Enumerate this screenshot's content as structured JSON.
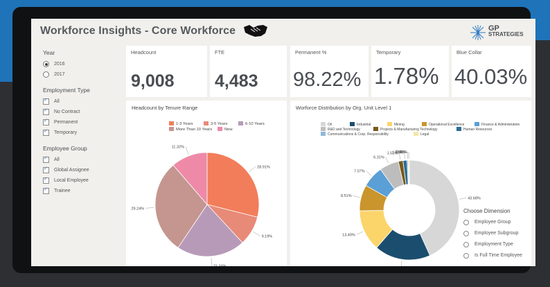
{
  "header": {
    "title": "Workforce Insights - Core Workforce",
    "logo_line1": "GP",
    "logo_line2": "STRATEGIES"
  },
  "filters": {
    "year": {
      "title": "Year",
      "options": [
        "2016",
        "2017"
      ],
      "selected": "2016"
    },
    "employment_type": {
      "title": "Employment Type",
      "options": [
        "All",
        "No Contract",
        "Permanent",
        "Temporary"
      ]
    },
    "employee_group": {
      "title": "Employee Group",
      "options": [
        "All",
        "Global Assignee",
        "Local Employee",
        "Trainee"
      ]
    }
  },
  "kpis": [
    {
      "label": "Headcount",
      "value": "9,008"
    },
    {
      "label": "FTE",
      "value": "4,483"
    },
    {
      "label": "Permanent %",
      "value": "98.22%"
    },
    {
      "label": "Temporary",
      "value": "1.78%"
    },
    {
      "label": "Blue Collar",
      "value": "40.03%"
    }
  ],
  "tenure_chart": {
    "title": "Headcount by Tenure Range"
  },
  "org_chart": {
    "title": "Worforce Distribution by Org. Unit Level 1"
  },
  "dimension": {
    "title": "Choose Dimension",
    "options": [
      "Employee Group",
      "Employee Subgroup",
      "Employment Type",
      "Is Full Time Employee"
    ]
  },
  "chart_data": [
    {
      "type": "pie",
      "title": "Headcount by Tenure Range",
      "legend_position": "top",
      "slices": [
        {
          "name": "1-3 Years",
          "value": 28.91,
          "label": "28.91%",
          "color": "#f27d5a"
        },
        {
          "name": "3-5 Years",
          "value": 9.19,
          "label": "9.19%",
          "color": "#e88a78"
        },
        {
          "name": "6-10 Years",
          "value": 21.34,
          "label": "21.34%",
          "color": "#b79ab8"
        },
        {
          "name": "More Than 10 Years",
          "value": 29.24,
          "label": "29.24%",
          "color": "#c4968f"
        },
        {
          "name": "New",
          "value": 11.32,
          "label": "11.32%",
          "color": "#ee8aa8"
        }
      ]
    },
    {
      "type": "pie",
      "donut": true,
      "title": "Worforce Distribution by Org. Unit Level 1",
      "legend_position": "top",
      "slices": [
        {
          "name": "Oil",
          "value": 43.68,
          "label": "43.68%",
          "color": "#d7d7d7"
        },
        {
          "name": "Industrial",
          "value": 18.34,
          "label": "18.34%",
          "color": "#1b4e6e"
        },
        {
          "name": "Mining",
          "value": 13.49,
          "label": "13.49%",
          "color": "#fbd56a"
        },
        {
          "name": "Operational Excellence",
          "value": 8.51,
          "label": "8.51%",
          "color": "#c9952c"
        },
        {
          "name": "Finance & Administration",
          "value": 7.07,
          "label": "7.07%",
          "color": "#5a9fd6"
        },
        {
          "name": "R&D and Technology",
          "value": 6.31,
          "label": "6.31%",
          "color": "#bdbdbd"
        },
        {
          "name": "Projects & Manufacturing Technology",
          "value": 1.51,
          "label": "1.51%",
          "color": "#7a5a1a"
        },
        {
          "name": "Human Resources",
          "value": 1.33,
          "label": "1.33%",
          "color": "#2c6e95"
        },
        {
          "name": "Communications & Corp. Responsibility",
          "value": 0.4,
          "label": "0.40%",
          "color": "#8fb9dc"
        },
        {
          "name": "Legal",
          "value": 0.36,
          "label": "0.36%",
          "color": "#f6e6a6"
        }
      ]
    }
  ]
}
